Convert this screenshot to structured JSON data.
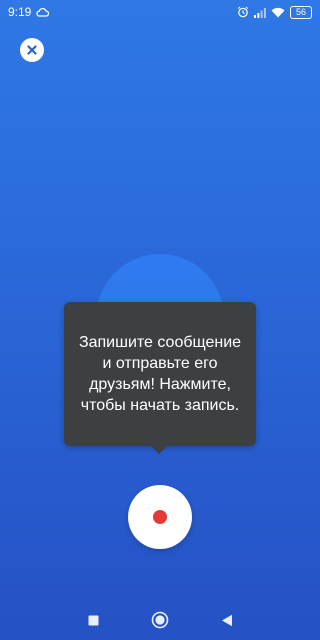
{
  "status_bar": {
    "time": "9:19",
    "battery": "56",
    "icons": [
      "cloud-icon",
      "alarm-icon",
      "signal-icon",
      "wifi-icon",
      "battery-icon"
    ]
  },
  "tooltip": {
    "text": "Запишите сообщение и отправьте его друзьям! Нажмите, чтобы начать запись."
  },
  "colors": {
    "background_top": "#2f78e6",
    "background_bottom": "#2551c4",
    "tooltip_bg": "#3c4043",
    "record_dot": "#e53935",
    "close_x": "#2b62d6"
  },
  "nav": {
    "icons": [
      "recents-icon",
      "home-icon",
      "back-icon"
    ]
  }
}
